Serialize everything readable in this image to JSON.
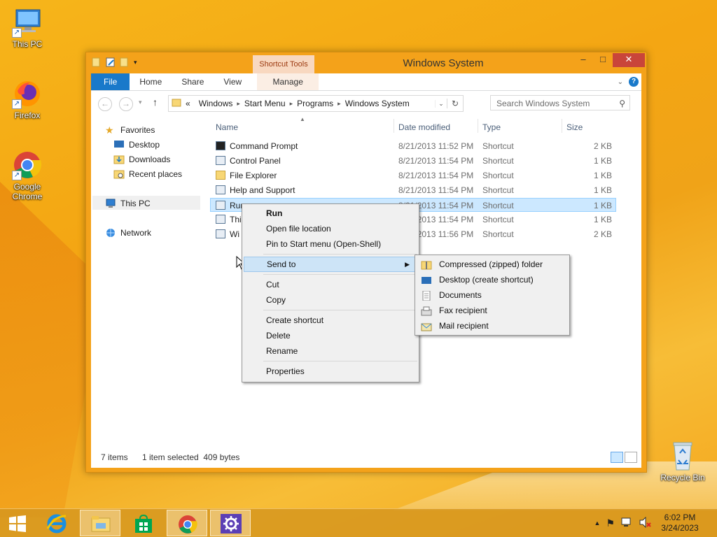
{
  "desktop": {
    "icons": [
      {
        "label": "This PC"
      },
      {
        "label": "Firefox"
      },
      {
        "label": "Google Chrome"
      },
      {
        "label": "Recycle Bin"
      }
    ]
  },
  "window": {
    "title": "Windows System",
    "context_tab_group": "Shortcut Tools",
    "controls": {
      "minimize": "–",
      "maximize": "□",
      "close": "✕"
    },
    "ribbon_tabs": [
      "File",
      "Home",
      "Share",
      "View",
      "Manage"
    ],
    "breadcrumb_prefix": "«",
    "breadcrumb": [
      "Windows",
      "Start Menu",
      "Programs",
      "Windows System"
    ],
    "search_placeholder": "Search Windows System",
    "nav": {
      "favorites": "Favorites",
      "favorites_items": [
        "Desktop",
        "Downloads",
        "Recent places"
      ],
      "this_pc": "This PC",
      "network": "Network"
    },
    "columns": [
      "Name",
      "Date modified",
      "Type",
      "Size"
    ],
    "files": [
      {
        "name": "Command Prompt",
        "date": "8/21/2013 11:52 PM",
        "type": "Shortcut",
        "size": "2 KB"
      },
      {
        "name": "Control Panel",
        "date": "8/21/2013 11:54 PM",
        "type": "Shortcut",
        "size": "1 KB"
      },
      {
        "name": "File Explorer",
        "date": "8/21/2013 11:54 PM",
        "type": "Shortcut",
        "size": "1 KB"
      },
      {
        "name": "Help and Support",
        "date": "8/21/2013 11:54 PM",
        "type": "Shortcut",
        "size": "1 KB"
      },
      {
        "name": "Run",
        "date": "8/21/2013 11:54 PM",
        "type": "Shortcut",
        "size": "1 KB"
      },
      {
        "name": "Thi",
        "date": "8/21/2013 11:54 PM",
        "type": "Shortcut",
        "size": "1 KB"
      },
      {
        "name": "Wi",
        "date": "8/21/2013 11:56 PM",
        "type": "Shortcut",
        "size": "2 KB"
      }
    ],
    "status": {
      "count": "7 items",
      "selection": "1 item selected  409 bytes"
    }
  },
  "context_menu": {
    "items": [
      "Run",
      "Open file location",
      "Pin to Start menu (Open-Shell)",
      "Send to",
      "Cut",
      "Copy",
      "Create shortcut",
      "Delete",
      "Rename",
      "Properties"
    ]
  },
  "send_to_menu": {
    "items": [
      "Compressed (zipped) folder",
      "Desktop (create shortcut)",
      "Documents",
      "Fax recipient",
      "Mail recipient"
    ]
  },
  "taskbar": {
    "time": "6:02 PM",
    "date": "3/24/2023"
  },
  "colors": {
    "accent": "#1979ca",
    "selection": "#cce8ff",
    "menu_highlight": "#cde4f7"
  }
}
